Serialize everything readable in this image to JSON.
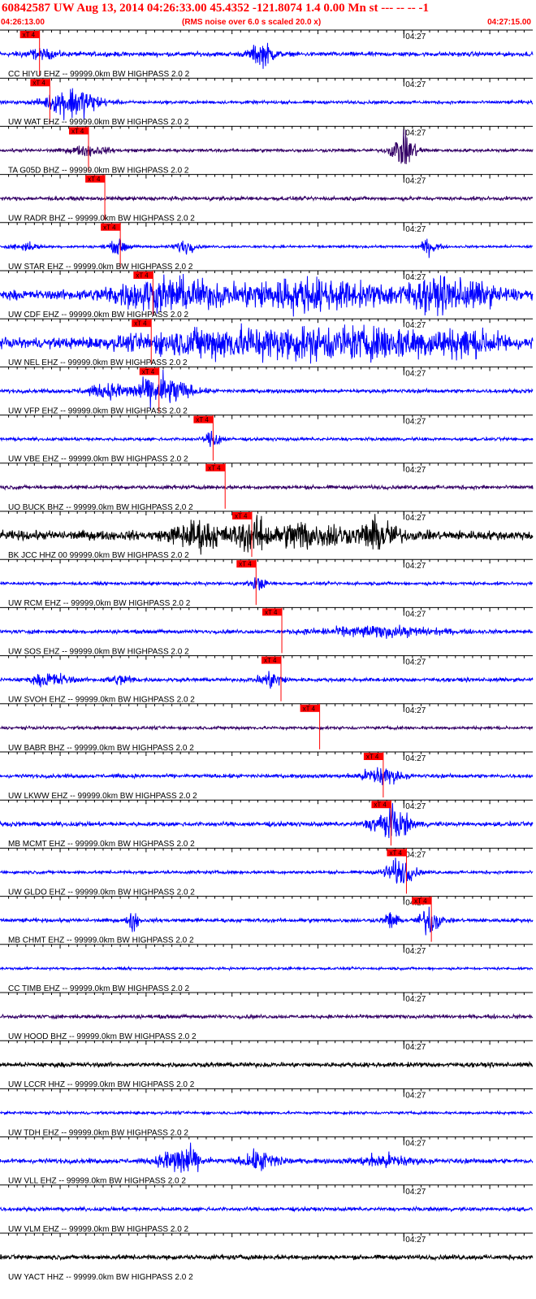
{
  "header": {
    "title": "60842587 UW Aug 13, 2014 04:26:33.00   45.4352 -121.8074  1.4 0.00 Mn st --- -- --  -1",
    "start_time": "04:26:13.00",
    "note": "(RMS noise over 6.0 s scaled 20.0 x)",
    "end_time": "04:27:15.00"
  },
  "chart_data": {
    "type": "line",
    "title": "60842587 UW Aug 13, 2014 04:26:33.00   45.4352 -121.8074  1.4 0.00 Mn st --- -- --  -1",
    "x_start": "04:26:13.00",
    "x_end": "04:27:15.00",
    "minute_tick_label": "04:27",
    "minute_tick_seconds": 47,
    "pick_label": "xT 4",
    "colors": {
      "pick": "#ff0000",
      "grid": "#000000"
    },
    "traces": [
      {
        "label": "CC HIYU EHZ -- 99999.0km BW  HIGHPASS  2.0  2",
        "color": "#0000ff",
        "pick_s": 4.6,
        "base": 0.14,
        "bursts": [
          [
            30.5,
            1.0,
            0.7
          ],
          [
            4.6,
            1.5,
            0.25
          ]
        ]
      },
      {
        "label": "UW WAT EHZ -- 99999.0km BW  HIGHPASS  2.0  2",
        "color": "#0000ff",
        "pick_s": 5.8,
        "base": 0.1,
        "bursts": [
          [
            8.5,
            2.0,
            1.0
          ]
        ]
      },
      {
        "label": "TA G05D BHZ -- 99999.0km BW  HIGHPASS  2.0  2",
        "color": "#330066",
        "pick_s": 10.3,
        "base": 0.1,
        "bursts": [
          [
            47.0,
            1.0,
            1.0
          ],
          [
            10.3,
            1.5,
            0.3
          ]
        ]
      },
      {
        "label": "UW RADR BHZ -- 99999.0km BW  HIGHPASS  2.0  2",
        "color": "#330066",
        "pick_s": 12.2,
        "base": 0.12,
        "bursts": []
      },
      {
        "label": "UW STAR EHZ -- 99999.0km BW  HIGHPASS  2.0  2",
        "color": "#0000ff",
        "pick_s": 14.0,
        "base": 0.08,
        "bursts": [
          [
            3.0,
            1.0,
            0.25
          ],
          [
            13.8,
            0.8,
            0.4
          ],
          [
            21.5,
            0.8,
            0.45
          ],
          [
            50.0,
            0.7,
            0.5
          ]
        ]
      },
      {
        "label": "UW CDF EHZ -- 99999.0km BW  HIGHPASS  2.0  2",
        "color": "#0000ff",
        "pick_s": 17.8,
        "base": 0.3,
        "bursts": [
          [
            19.0,
            4.0,
            1.0
          ],
          [
            35.0,
            6.0,
            0.9
          ],
          [
            52.0,
            4.0,
            0.9
          ]
        ]
      },
      {
        "label": "UW NEL EHZ -- 99999.0km BW  HIGHPASS  2.0  2",
        "color": "#0000ff",
        "pick_s": 17.6,
        "base": 0.3,
        "bursts": [
          [
            30.0,
            9.0,
            1.0
          ],
          [
            45.0,
            5.0,
            0.7
          ],
          [
            55.0,
            3.0,
            0.6
          ]
        ]
      },
      {
        "label": "UW VFP EHZ -- 99999.0km BW  HIGHPASS  2.0  2",
        "color": "#0000ff",
        "pick_s": 18.5,
        "base": 0.12,
        "bursts": [
          [
            19.0,
            2.0,
            1.0
          ],
          [
            13.0,
            2.0,
            0.4
          ]
        ]
      },
      {
        "label": "UW VBE EHZ -- 99999.0km BW  HIGHPASS  2.0  2",
        "color": "#0000ff",
        "pick_s": 24.8,
        "base": 0.1,
        "bursts": [
          [
            24.9,
            0.6,
            0.6
          ]
        ]
      },
      {
        "label": "UO BUCK BHZ -- 99999.0km BW  HIGHPASS  2.0  2",
        "color": "#330066",
        "pick_s": 26.2,
        "base": 0.12,
        "bursts": []
      },
      {
        "label": "BK JCC HHZ 00 99999.0km BW  HIGHPASS  2.0  2",
        "color": "#000000",
        "pick_s": 29.3,
        "base": 0.3,
        "bursts": [
          [
            23.0,
            2.0,
            0.8
          ],
          [
            29.5,
            1.5,
            1.0
          ],
          [
            35.0,
            1.5,
            0.9
          ],
          [
            44.0,
            1.5,
            1.0
          ],
          [
            39.0,
            1.0,
            0.6
          ]
        ]
      },
      {
        "label": "UW RCM EHZ -- 99999.0km BW  HIGHPASS  2.0  2",
        "color": "#0000ff",
        "pick_s": 29.8,
        "base": 0.1,
        "bursts": [
          [
            30.0,
            0.6,
            0.4
          ]
        ]
      },
      {
        "label": "UW SOS EHZ -- 99999.0km BW  HIGHPASS  2.0  2",
        "color": "#0000ff",
        "pick_s": 32.8,
        "base": 0.12,
        "bursts": [
          [
            44.0,
            5.0,
            0.3
          ]
        ]
      },
      {
        "label": "UW SVOH EHZ -- 99999.0km BW  HIGHPASS  2.0  2",
        "color": "#0000ff",
        "pick_s": 32.7,
        "base": 0.12,
        "bursts": [
          [
            6.0,
            1.5,
            0.4
          ],
          [
            14.0,
            1.0,
            0.3
          ],
          [
            31.5,
            1.0,
            0.5
          ]
        ]
      },
      {
        "label": "UW BABR BHZ -- 99999.0km BW  HIGHPASS  2.0  2",
        "color": "#330066",
        "pick_s": 37.2,
        "base": 0.1,
        "bursts": []
      },
      {
        "label": "UW LKWW EHZ -- 99999.0km BW  HIGHPASS  2.0  2",
        "color": "#0000ff",
        "pick_s": 44.6,
        "base": 0.12,
        "bursts": [
          [
            44.3,
            1.5,
            0.6
          ]
        ]
      },
      {
        "label": "MB MCMT EHZ -- 99999.0km BW  HIGHPASS  2.0  2",
        "color": "#0000ff",
        "pick_s": 45.5,
        "base": 0.14,
        "bursts": [
          [
            45.5,
            1.5,
            1.0
          ]
        ]
      },
      {
        "label": "UW GLDO EHZ -- 99999.0km BW  HIGHPASS  2.0  2",
        "color": "#0000ff",
        "pick_s": 47.3,
        "base": 0.1,
        "bursts": [
          [
            46.5,
            1.2,
            0.8
          ]
        ]
      },
      {
        "label": "MB CHMT EHZ -- 99999.0km BW  HIGHPASS  2.0  2",
        "color": "#0000ff",
        "pick_s": 50.2,
        "base": 0.12,
        "bursts": [
          [
            15.5,
            0.4,
            0.7
          ],
          [
            45.5,
            0.5,
            0.6
          ],
          [
            50.0,
            0.8,
            0.9
          ]
        ]
      },
      {
        "label": "CC TIMB EHZ -- 99999.0km BW  HIGHPASS  2.0  2",
        "color": "#0000ff",
        "pick_s": null,
        "base": 0.08,
        "bursts": []
      },
      {
        "label": "UW HOOD BHZ -- 99999.0km BW  HIGHPASS  2.0  2",
        "color": "#330066",
        "pick_s": null,
        "base": 0.12,
        "bursts": []
      },
      {
        "label": "UW LCCR HHZ -- 99999.0km BW  HIGHPASS  2.0  2",
        "color": "#000000",
        "pick_s": null,
        "base": 0.15,
        "bursts": []
      },
      {
        "label": "UW TDH EHZ -- 99999.0km BW  HIGHPASS  2.0  2",
        "color": "#0000ff",
        "pick_s": null,
        "base": 0.09,
        "bursts": []
      },
      {
        "label": "UW VLL EHZ -- 99999.0km BW  HIGHPASS  2.0  2",
        "color": "#0000ff",
        "pick_s": null,
        "base": 0.15,
        "bursts": [
          [
            21.0,
            1.5,
            1.0
          ],
          [
            30.5,
            1.5,
            0.6
          ],
          [
            45.0,
            2.0,
            0.4
          ]
        ]
      },
      {
        "label": "UW VLM EHZ -- 99999.0km BW  HIGHPASS  2.0  2",
        "color": "#0000ff",
        "pick_s": null,
        "base": 0.12,
        "bursts": []
      },
      {
        "label": "UW YACT HHZ -- 99999.0km BW  HIGHPASS  2.0  2",
        "color": "#000000",
        "pick_s": null,
        "base": 0.15,
        "bursts": []
      }
    ]
  }
}
